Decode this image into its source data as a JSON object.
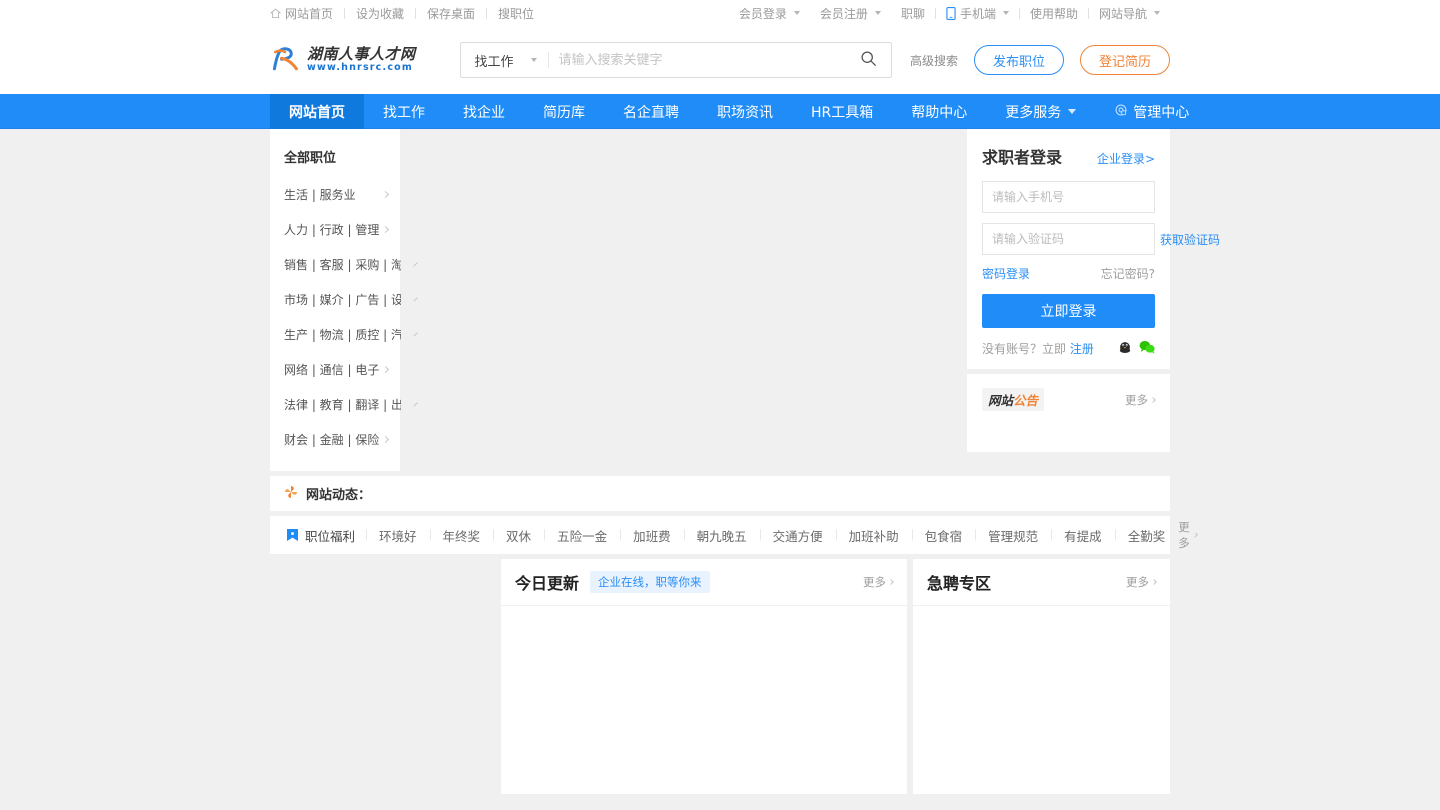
{
  "topbar": {
    "left": [
      {
        "label": "网站首页",
        "icon": "home-icon"
      },
      {
        "label": "设为收藏",
        "icon": ""
      },
      {
        "label": "保存桌面",
        "icon": ""
      },
      {
        "label": "搜职位",
        "icon": ""
      }
    ],
    "right": [
      {
        "label": "会员登录",
        "caret": true,
        "icon": ""
      },
      {
        "label": "会员注册",
        "caret": true,
        "icon": ""
      },
      {
        "label": "职聊",
        "caret": false,
        "icon": ""
      },
      {
        "label": "手机端",
        "caret": true,
        "icon": "phone-icon"
      },
      {
        "label": "使用帮助",
        "caret": false,
        "icon": ""
      },
      {
        "label": "网站导航",
        "caret": true,
        "icon": ""
      }
    ]
  },
  "header": {
    "logo_cn": "湖南人事人才网",
    "logo_url": "www.hnrsrc.com",
    "search": {
      "type_label": "找工作",
      "placeholder": "请输入搜索关键字",
      "value": "",
      "search_icon": "search-icon"
    },
    "advanced_label": "高级搜索",
    "post_job_label": "发布职位",
    "register_resume_label": "登记简历"
  },
  "nav": {
    "items": [
      {
        "label": "网站首页",
        "active": true,
        "caret": false
      },
      {
        "label": "找工作",
        "active": false,
        "caret": false
      },
      {
        "label": "找企业",
        "active": false,
        "caret": false
      },
      {
        "label": "简历库",
        "active": false,
        "caret": false
      },
      {
        "label": "名企直聘",
        "active": false,
        "caret": false
      },
      {
        "label": "职场资讯",
        "active": false,
        "caret": false
      },
      {
        "label": "HR工具箱",
        "active": false,
        "caret": false
      },
      {
        "label": "帮助中心",
        "active": false,
        "caret": false
      },
      {
        "label": "更多服务",
        "active": false,
        "caret": true
      }
    ],
    "admin_label": "管理中心",
    "admin_icon": "gear-icon"
  },
  "categories": {
    "title": "全部职位",
    "items": [
      {
        "label": "生活 | 服务业"
      },
      {
        "label": "人力 | 行政 | 管理"
      },
      {
        "label": "销售 | 客服 | 采购 | 淘宝"
      },
      {
        "label": "市场 | 媒介 | 广告 | 设计"
      },
      {
        "label": "生产 | 物流 | 质控 | 汽车"
      },
      {
        "label": "网络 | 通信 | 电子"
      },
      {
        "label": "法律 | 教育 | 翻译 | 出版"
      },
      {
        "label": "财会 | 金融 | 保险"
      }
    ]
  },
  "login": {
    "title": "求职者登录",
    "corp_login": "企业登录>",
    "phone_placeholder": "请输入手机号",
    "phone_value": "",
    "code_placeholder": "请输入验证码",
    "code_value": "",
    "get_code": "获取验证码",
    "password_login": "密码登录",
    "forgot": "忘记密码?",
    "submit": "立即登录",
    "no_account": "没有账号？立即",
    "register": "注册",
    "socials": [
      "qq-icon",
      "wechat-icon"
    ]
  },
  "notice": {
    "tag_part1": "网站",
    "tag_part2": "公告",
    "more": "更多"
  },
  "dynamics": {
    "icon": "pinwheel-icon",
    "label": "网站动态："
  },
  "tags": {
    "first": {
      "label": "职位福利",
      "icon": "bookmark-icon"
    },
    "items": [
      "环境好",
      "年终奖",
      "双休",
      "五险一金",
      "加班费",
      "朝九晚五",
      "交通方便",
      "加班补助",
      "包食宿",
      "管理规范",
      "有提成",
      "全勤奖"
    ],
    "more": "更多"
  },
  "cards": [
    {
      "title": "今日更新",
      "badge": "企业在线，职等你来",
      "more": "更多"
    },
    {
      "title": "急聘专区",
      "badge": "",
      "more": "更多"
    }
  ],
  "colors": {
    "brand_blue": "#1f8cf7",
    "nav_active": "#1079dd",
    "accent_orange": "#f08437",
    "link_blue": "#2a8ef5",
    "page_bg": "#f0f0f0"
  }
}
